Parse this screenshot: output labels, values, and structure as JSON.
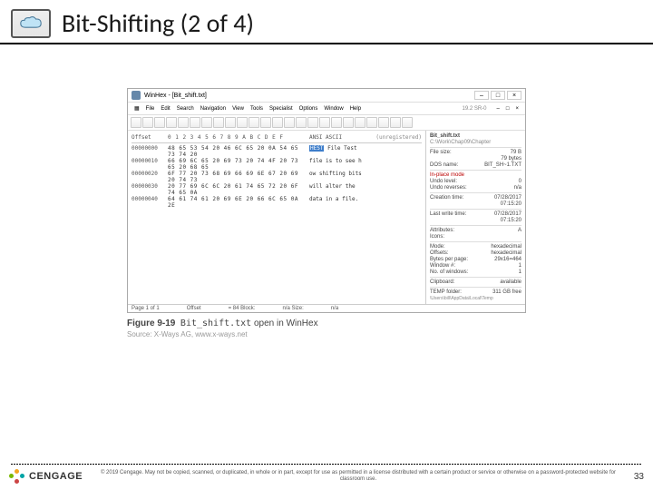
{
  "header": {
    "title": "Bit-Shifting (2 of 4)"
  },
  "window": {
    "title": "WinHex - [Bit_shift.txt]",
    "menus": [
      "File",
      "Edit",
      "Search",
      "Navigation",
      "View",
      "Tools",
      "Specialist",
      "Options",
      "Window",
      "Help"
    ],
    "version": "19.2 SR-0",
    "hex_header_offset": "Offset",
    "hex_header_cols": "0  1  2  3  4  5  6  7  8  9  A  B  C  D  E  F",
    "hex_header_asc": "ANSI ASCII",
    "unregistered": "(unregistered)",
    "rows": [
      {
        "off": "00000000",
        "hx": "48 65 53 54 20 46 6C 65 20 0A 54 65 73 74 20",
        "asc_pre": "",
        "asc_hl": "HEST",
        "asc_post": " File  Test"
      },
      {
        "off": "00000010",
        "hx": "66 69 6C 65 20 69 73 20 74 4F 20 73 65 20 68 65",
        "asc_pre": "file is to see h",
        "asc_hl": "",
        "asc_post": ""
      },
      {
        "off": "00000020",
        "hx": "6F 77 20 73 68 69 66 69 6E 67 20 69 20 74 73",
        "asc_pre": "ow shifting bits",
        "asc_hl": "",
        "asc_post": ""
      },
      {
        "off": "00000030",
        "hx": "20 77 69 6C 6C 20 61 74 65 72 20 6F 74 65 0A",
        "asc_pre": " will alter the",
        "asc_hl": "",
        "asc_post": ""
      },
      {
        "off": "00000040",
        "hx": "64 61 74 61 20 69 6E 20 66 6C 65 0A 2E",
        "asc_pre": "data in a file.",
        "asc_hl": "",
        "asc_post": ""
      }
    ],
    "right": {
      "filename": "Bit_shift.txt",
      "path": "C:\\Work\\Chap09\\Chapter",
      "filesize_lbl": "File size:",
      "filesize": "79 B",
      "bytes": "79 bytes",
      "dosname_lbl": "DOS name:",
      "dosname": "BIT_SH~1.TXT",
      "mode": "In-place mode",
      "undolvl_lbl": "Undo level:",
      "undolvl": "0",
      "undorev_lbl": "Undo reverses:",
      "undorev": "n/a",
      "ctime_lbl": "Creation time:",
      "ctime": "07/28/2017",
      "ctime2": "07:15:20",
      "wtime_lbl": "Last write time:",
      "wtime": "07/28/2017",
      "wtime2": "07:15:20",
      "attr_lbl": "Attributes:",
      "attr": "A",
      "icons_lbl": "Icons:",
      "icons": "",
      "mode2_lbl": "Mode:",
      "mode2": "hexadecimal",
      "offsets_lbl": "Offsets:",
      "offsets": "hexadecimal",
      "bpp_lbl": "Bytes per page:",
      "bpp": "29x16=464",
      "winnum_lbl": "Window #:",
      "winnum": "1",
      "numwin_lbl": "No. of windows:",
      "numwin": "1",
      "clip_lbl": "Clipboard:",
      "clip": "available",
      "temp_lbl": "TEMP folder:",
      "temp": "311 GB free",
      "temppath": "\\Users\\bill\\AppData\\Local\\Temp"
    },
    "status": {
      "page": "Page 1 of 1",
      "offset": "Offset",
      "val": "= 84  Block:",
      "na1": "n/a   Size:",
      "na2": "n/a"
    }
  },
  "caption": {
    "fig": "Figure 9-19",
    "filename": "Bit_shift.txt",
    "rest": " open in WinHex"
  },
  "source": "Source: X-Ways AG, www.x-ways.net",
  "footer": {
    "brand": "CENGAGE",
    "copyright": "© 2019 Cengage. May not be copied, scanned, or duplicated, in whole or in part, except for use as permitted in a license distributed with a certain product or service or otherwise on a password-protected website for classroom use.",
    "page": "33"
  }
}
